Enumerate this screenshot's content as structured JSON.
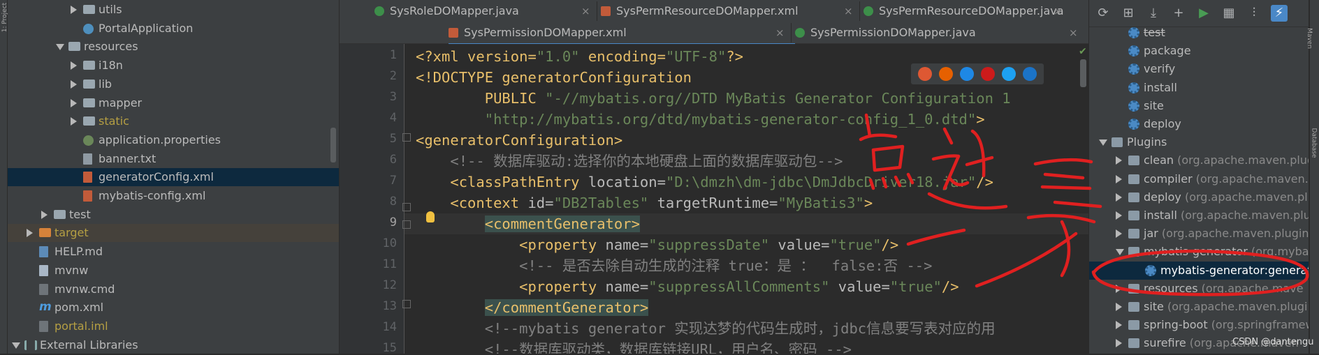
{
  "left_strip": {
    "label": "1: Project"
  },
  "project_tree": [
    {
      "label": "utils",
      "icon": "folder-icon",
      "depth": 4,
      "expand": "collapsed"
    },
    {
      "label": "PortalApplication",
      "icon": "spring-boot-class-icon",
      "depth": 4,
      "expand": "none"
    },
    {
      "label": "resources",
      "icon": "resources-folder-icon",
      "depth": 3,
      "expand": "expanded"
    },
    {
      "label": "i18n",
      "icon": "folder-icon",
      "depth": 4,
      "expand": "collapsed"
    },
    {
      "label": "lib",
      "icon": "folder-icon",
      "depth": 4,
      "expand": "collapsed"
    },
    {
      "label": "mapper",
      "icon": "folder-icon",
      "depth": 4,
      "expand": "collapsed"
    },
    {
      "label": "static",
      "icon": "folder-icon",
      "depth": 4,
      "expand": "collapsed",
      "color": "#b59f43"
    },
    {
      "label": "application.properties",
      "icon": "properties-file-icon",
      "depth": 4,
      "expand": "none"
    },
    {
      "label": "banner.txt",
      "icon": "text-file-icon",
      "depth": 4,
      "expand": "none"
    },
    {
      "label": "generatorConfig.xml",
      "icon": "xml-file-icon",
      "depth": 4,
      "expand": "none",
      "selected": true
    },
    {
      "label": "mybatis-config.xml",
      "icon": "xml-file-icon",
      "depth": 4,
      "expand": "none"
    },
    {
      "label": "test",
      "icon": "folder-icon",
      "depth": 2,
      "expand": "collapsed"
    },
    {
      "label": "target",
      "icon": "excluded-folder-icon",
      "depth": 1,
      "expand": "collapsed",
      "color": "#b59f43",
      "highlight": true
    },
    {
      "label": "HELP.md",
      "icon": "markdown-file-icon",
      "depth": 1,
      "expand": "none"
    },
    {
      "label": "mvnw",
      "icon": "file-icon",
      "depth": 1,
      "expand": "none"
    },
    {
      "label": "mvnw.cmd",
      "icon": "cmd-file-icon",
      "depth": 1,
      "expand": "none"
    },
    {
      "label": "pom.xml",
      "icon": "maven-pom-icon",
      "depth": 1,
      "expand": "none"
    },
    {
      "label": "portal.iml",
      "icon": "iml-file-icon",
      "depth": 1,
      "expand": "none",
      "color": "#b59f43"
    },
    {
      "label": "External Libraries",
      "icon": "libraries-icon",
      "depth": 0,
      "expand": "expanded"
    }
  ],
  "editor_tabs_row1": [
    {
      "label": "SysRoleDOMapper.java",
      "type": "java"
    },
    {
      "label": "SysPermResourceDOMapper.xml",
      "type": "xml"
    },
    {
      "label": "SysPermResourceDOMapper.java",
      "type": "java"
    }
  ],
  "editor_tabs_row2": [
    {
      "label": "SysPermissionDOMapper.xml",
      "type": "xml",
      "active": true
    },
    {
      "label": "SysPermissionDOMapper.java",
      "type": "java"
    }
  ],
  "close_glyph": "×",
  "line_numbers": [
    "1",
    "2",
    "3",
    "4",
    "5",
    "6",
    "7",
    "8",
    "9",
    "10",
    "11",
    "12",
    "13",
    "14",
    "15"
  ],
  "current_line": "9",
  "code_lines": [
    [
      {
        "t": "<?xml version=",
        "c": "pi"
      },
      {
        "t": "\"1.0\"",
        "c": "val"
      },
      {
        "t": " encoding=",
        "c": "pi"
      },
      {
        "t": "\"UTF-8\"",
        "c": "val"
      },
      {
        "t": "?>",
        "c": "pi"
      }
    ],
    [
      {
        "t": "<!DOCTYPE generatorConfiguration",
        "c": "doc"
      }
    ],
    [
      {
        "t": "        PUBLIC ",
        "c": "doc"
      },
      {
        "t": "\"-//mybatis.org//DTD MyBatis Generator Configuration 1",
        "c": "dtd"
      }
    ],
    [
      {
        "t": "        \"http://mybatis.org/dtd/mybatis-generator-config_1_0.dtd\"",
        "c": "dtd"
      },
      {
        "t": ">",
        "c": "doc"
      }
    ],
    [
      {
        "t": "<generatorConfiguration>",
        "c": "tag"
      }
    ],
    [
      {
        "t": "    <!-- 数据库驱动:选择你的本地硬盘上面的数据库驱动包-->",
        "c": "com"
      }
    ],
    [
      {
        "t": "    <classPathEntry ",
        "c": "tag"
      },
      {
        "t": "location=",
        "c": "attr"
      },
      {
        "t": "\"D:\\dmzh\\dm-jdbc\\DmJdbcDriver18.jar\"",
        "c": "val"
      },
      {
        "t": "/>",
        "c": "tag"
      }
    ],
    [
      {
        "t": "    <context ",
        "c": "tag"
      },
      {
        "t": "id=",
        "c": "attr"
      },
      {
        "t": "\"DB2Tables\"",
        "c": "val"
      },
      {
        "t": " targetRuntime=",
        "c": "attr"
      },
      {
        "t": "\"MyBatis3\"",
        "c": "val"
      },
      {
        "t": ">",
        "c": "tag"
      }
    ],
    [
      {
        "t": "        ",
        "c": "txt"
      },
      {
        "t": "<commentGenerator>",
        "c": "taghl"
      }
    ],
    [
      {
        "t": "            <property ",
        "c": "tag"
      },
      {
        "t": "name=",
        "c": "attr"
      },
      {
        "t": "\"suppressDate\"",
        "c": "val"
      },
      {
        "t": " value=",
        "c": "attr"
      },
      {
        "t": "\"true\"",
        "c": "val"
      },
      {
        "t": "/>",
        "c": "tag"
      }
    ],
    [
      {
        "t": "            <!-- 是否去除自动生成的注释 true：是 ：  false:否 -->",
        "c": "com"
      }
    ],
    [
      {
        "t": "            <property ",
        "c": "tag"
      },
      {
        "t": "name=",
        "c": "attr"
      },
      {
        "t": "\"suppressAllComments\"",
        "c": "val"
      },
      {
        "t": " value=",
        "c": "attr"
      },
      {
        "t": "\"true\"",
        "c": "val"
      },
      {
        "t": "/>",
        "c": "tag"
      }
    ],
    [
      {
        "t": "        ",
        "c": "txt"
      },
      {
        "t": "</commentGenerator>",
        "c": "taghl"
      }
    ],
    [
      {
        "t": "        <!--mybatis generator 实现达梦的代码生成时，jdbc信息要写表对应的用",
        "c": "com"
      }
    ],
    [
      {
        "t": "        <!--数据库驱动类，数据库链接URL，用户名、密码 -->",
        "c": "com"
      }
    ]
  ],
  "browser_icons": [
    "chrome-icon",
    "firefox-icon",
    "safari-icon",
    "opera-icon",
    "ie-icon",
    "edge-icon"
  ],
  "browser_colors": [
    "#de5833",
    "#e66000",
    "#1e88e5",
    "#cc1b1b",
    "#1da1f2",
    "#1b73c7"
  ],
  "maven_toolbar": [
    "refresh-icon",
    "reimport-icon",
    "download-icon",
    "add-icon",
    "run-icon",
    "execute-goal-icon",
    "toggle-offline-icon",
    "skip-tests-icon"
  ],
  "maven_toolbar_glyphs": [
    "⟳",
    "⊞",
    "⤓",
    "+",
    "▶",
    "▦",
    "⫶",
    "⚡"
  ],
  "maven_tree": [
    {
      "label": "test",
      "icon": "lifecycle-gear-icon",
      "depth": 2,
      "expand": "none",
      "strike": true
    },
    {
      "label": "package",
      "icon": "lifecycle-gear-icon",
      "depth": 2,
      "expand": "none"
    },
    {
      "label": "verify",
      "icon": "lifecycle-gear-icon",
      "depth": 2,
      "expand": "none"
    },
    {
      "label": "install",
      "icon": "lifecycle-gear-icon",
      "depth": 2,
      "expand": "none"
    },
    {
      "label": "site",
      "icon": "lifecycle-gear-icon",
      "depth": 2,
      "expand": "none"
    },
    {
      "label": "deploy",
      "icon": "lifecycle-gear-icon",
      "depth": 2,
      "expand": "none"
    },
    {
      "label": "Plugins",
      "icon": "plugins-folder-icon",
      "depth": 1,
      "expand": "expanded"
    },
    {
      "label": "clean",
      "suffix": "(org.apache.maven.plugi",
      "icon": "plugin-icon",
      "depth": 2,
      "expand": "collapsed"
    },
    {
      "label": "compiler",
      "suffix": "(org.apache.maven.pl",
      "icon": "plugin-icon",
      "depth": 2,
      "expand": "collapsed"
    },
    {
      "label": "deploy",
      "suffix": "(org.apache.maven.plu",
      "icon": "plugin-icon",
      "depth": 2,
      "expand": "collapsed"
    },
    {
      "label": "install",
      "suffix": "(org.apache.maven.plu",
      "icon": "plugin-icon",
      "depth": 2,
      "expand": "collapsed"
    },
    {
      "label": "jar",
      "suffix": "(org.apache.maven.plugins",
      "icon": "plugin-icon",
      "depth": 2,
      "expand": "collapsed"
    },
    {
      "label": "mybatis-generator",
      "suffix": "(org.mybat",
      "icon": "plugin-icon",
      "depth": 2,
      "expand": "expanded"
    },
    {
      "label": "mybatis-generator:generat",
      "icon": "goal-icon",
      "depth": 3,
      "expand": "none",
      "selected": true
    },
    {
      "label": "resources",
      "suffix": "(org.apache.mave",
      "icon": "plugin-icon",
      "depth": 2,
      "expand": "collapsed"
    },
    {
      "label": "site",
      "suffix": "(org.apache.maven.plugin",
      "icon": "plugin-icon",
      "depth": 2,
      "expand": "collapsed"
    },
    {
      "label": "spring-boot",
      "suffix": "(org.springframew",
      "icon": "plugin-icon",
      "depth": 2,
      "expand": "collapsed"
    },
    {
      "label": "surefire",
      "suffix": "(org.apache.maven",
      "icon": "plugin-icon",
      "depth": 2,
      "expand": "collapsed"
    }
  ],
  "right_strip": {
    "labels": [
      "Maven",
      "Database"
    ]
  },
  "annotation": {
    "label": "点这里",
    "color": "#e02020"
  },
  "watermark": "CSDN @dantengu"
}
